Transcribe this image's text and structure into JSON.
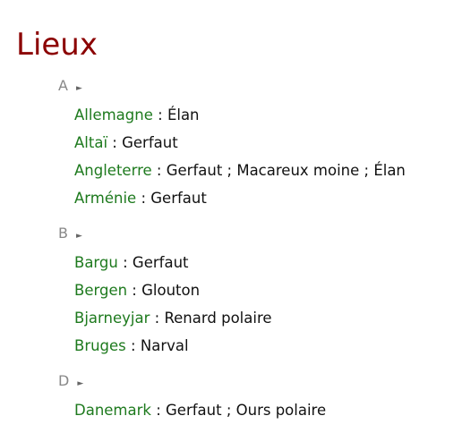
{
  "title": "Lieux",
  "toggle_glyph": "►",
  "separator": " : ",
  "sections": [
    {
      "letter": "A",
      "entries": [
        {
          "place": "Allemagne",
          "animals": "Élan"
        },
        {
          "place": "Altaï",
          "animals": "Gerfaut"
        },
        {
          "place": "Angleterre",
          "animals": "Gerfaut ; Macareux moine ; Élan"
        },
        {
          "place": "Arménie",
          "animals": "Gerfaut"
        }
      ]
    },
    {
      "letter": "B",
      "entries": [
        {
          "place": "Bargu",
          "animals": "Gerfaut"
        },
        {
          "place": "Bergen",
          "animals": "Glouton"
        },
        {
          "place": "Bjarneyjar",
          "animals": "Renard polaire"
        },
        {
          "place": "Bruges",
          "animals": "Narval"
        }
      ]
    },
    {
      "letter": "D",
      "entries": [
        {
          "place": "Danemark",
          "animals": "Gerfaut ; Ours polaire"
        }
      ]
    }
  ]
}
